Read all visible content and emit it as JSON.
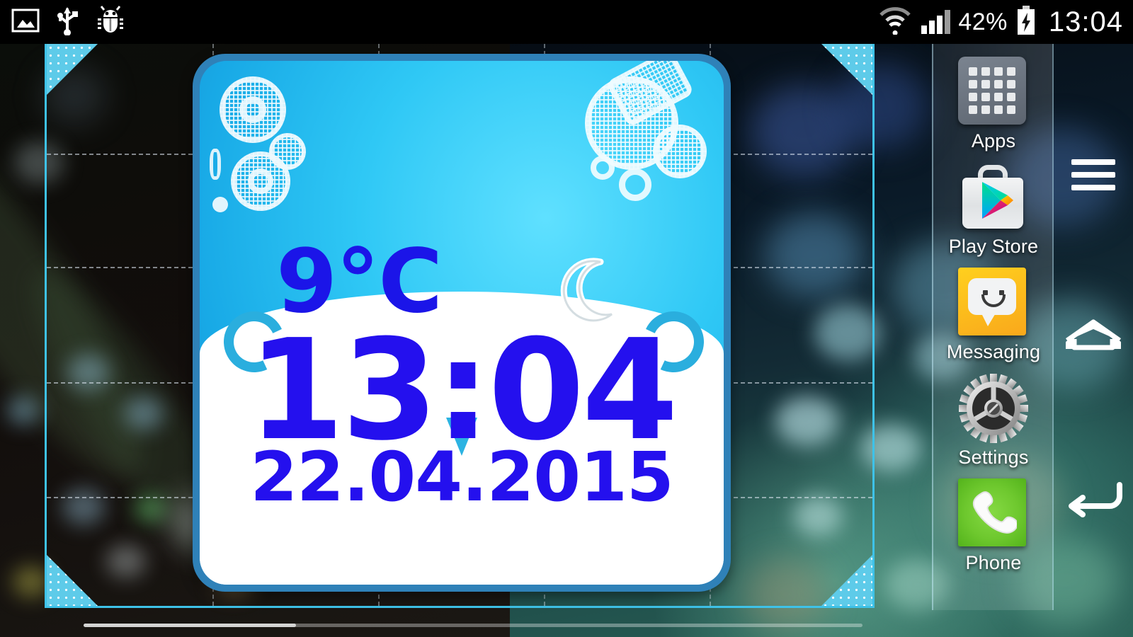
{
  "status_bar": {
    "left_icons": [
      "screenshot-icon",
      "usb-icon",
      "bug-icon"
    ],
    "wifi_icon": "wifi-icon",
    "signal_icon": "signal-bars-icon",
    "battery_percent": "42%",
    "battery_icon": "battery-charging-icon",
    "clock": "13:04"
  },
  "widget": {
    "temperature": "9°C",
    "weather_icon": "crescent-moon-icon",
    "time": "13:04",
    "date": "22.04.2015",
    "accent_blue": "#2410ee",
    "sky_cyan": "#2fc8f5",
    "frame_blue": "#2f81b8"
  },
  "resize_overlay": {
    "border_color": "#3ec2e8",
    "handle_color": "#5ecbe9",
    "handles": [
      "top-left",
      "top-right",
      "bottom-left",
      "bottom-right"
    ]
  },
  "dock": {
    "items": [
      {
        "label": "Apps",
        "icon": "apps-grid-icon"
      },
      {
        "label": "Play Store",
        "icon": "play-store-icon"
      },
      {
        "label": "Messaging",
        "icon": "messaging-icon"
      },
      {
        "label": "Settings",
        "icon": "settings-gear-icon"
      },
      {
        "label": "Phone",
        "icon": "phone-handset-icon"
      }
    ]
  },
  "navbar": {
    "buttons": [
      {
        "name": "menu-icon"
      },
      {
        "name": "home-icon"
      },
      {
        "name": "back-icon"
      }
    ]
  }
}
